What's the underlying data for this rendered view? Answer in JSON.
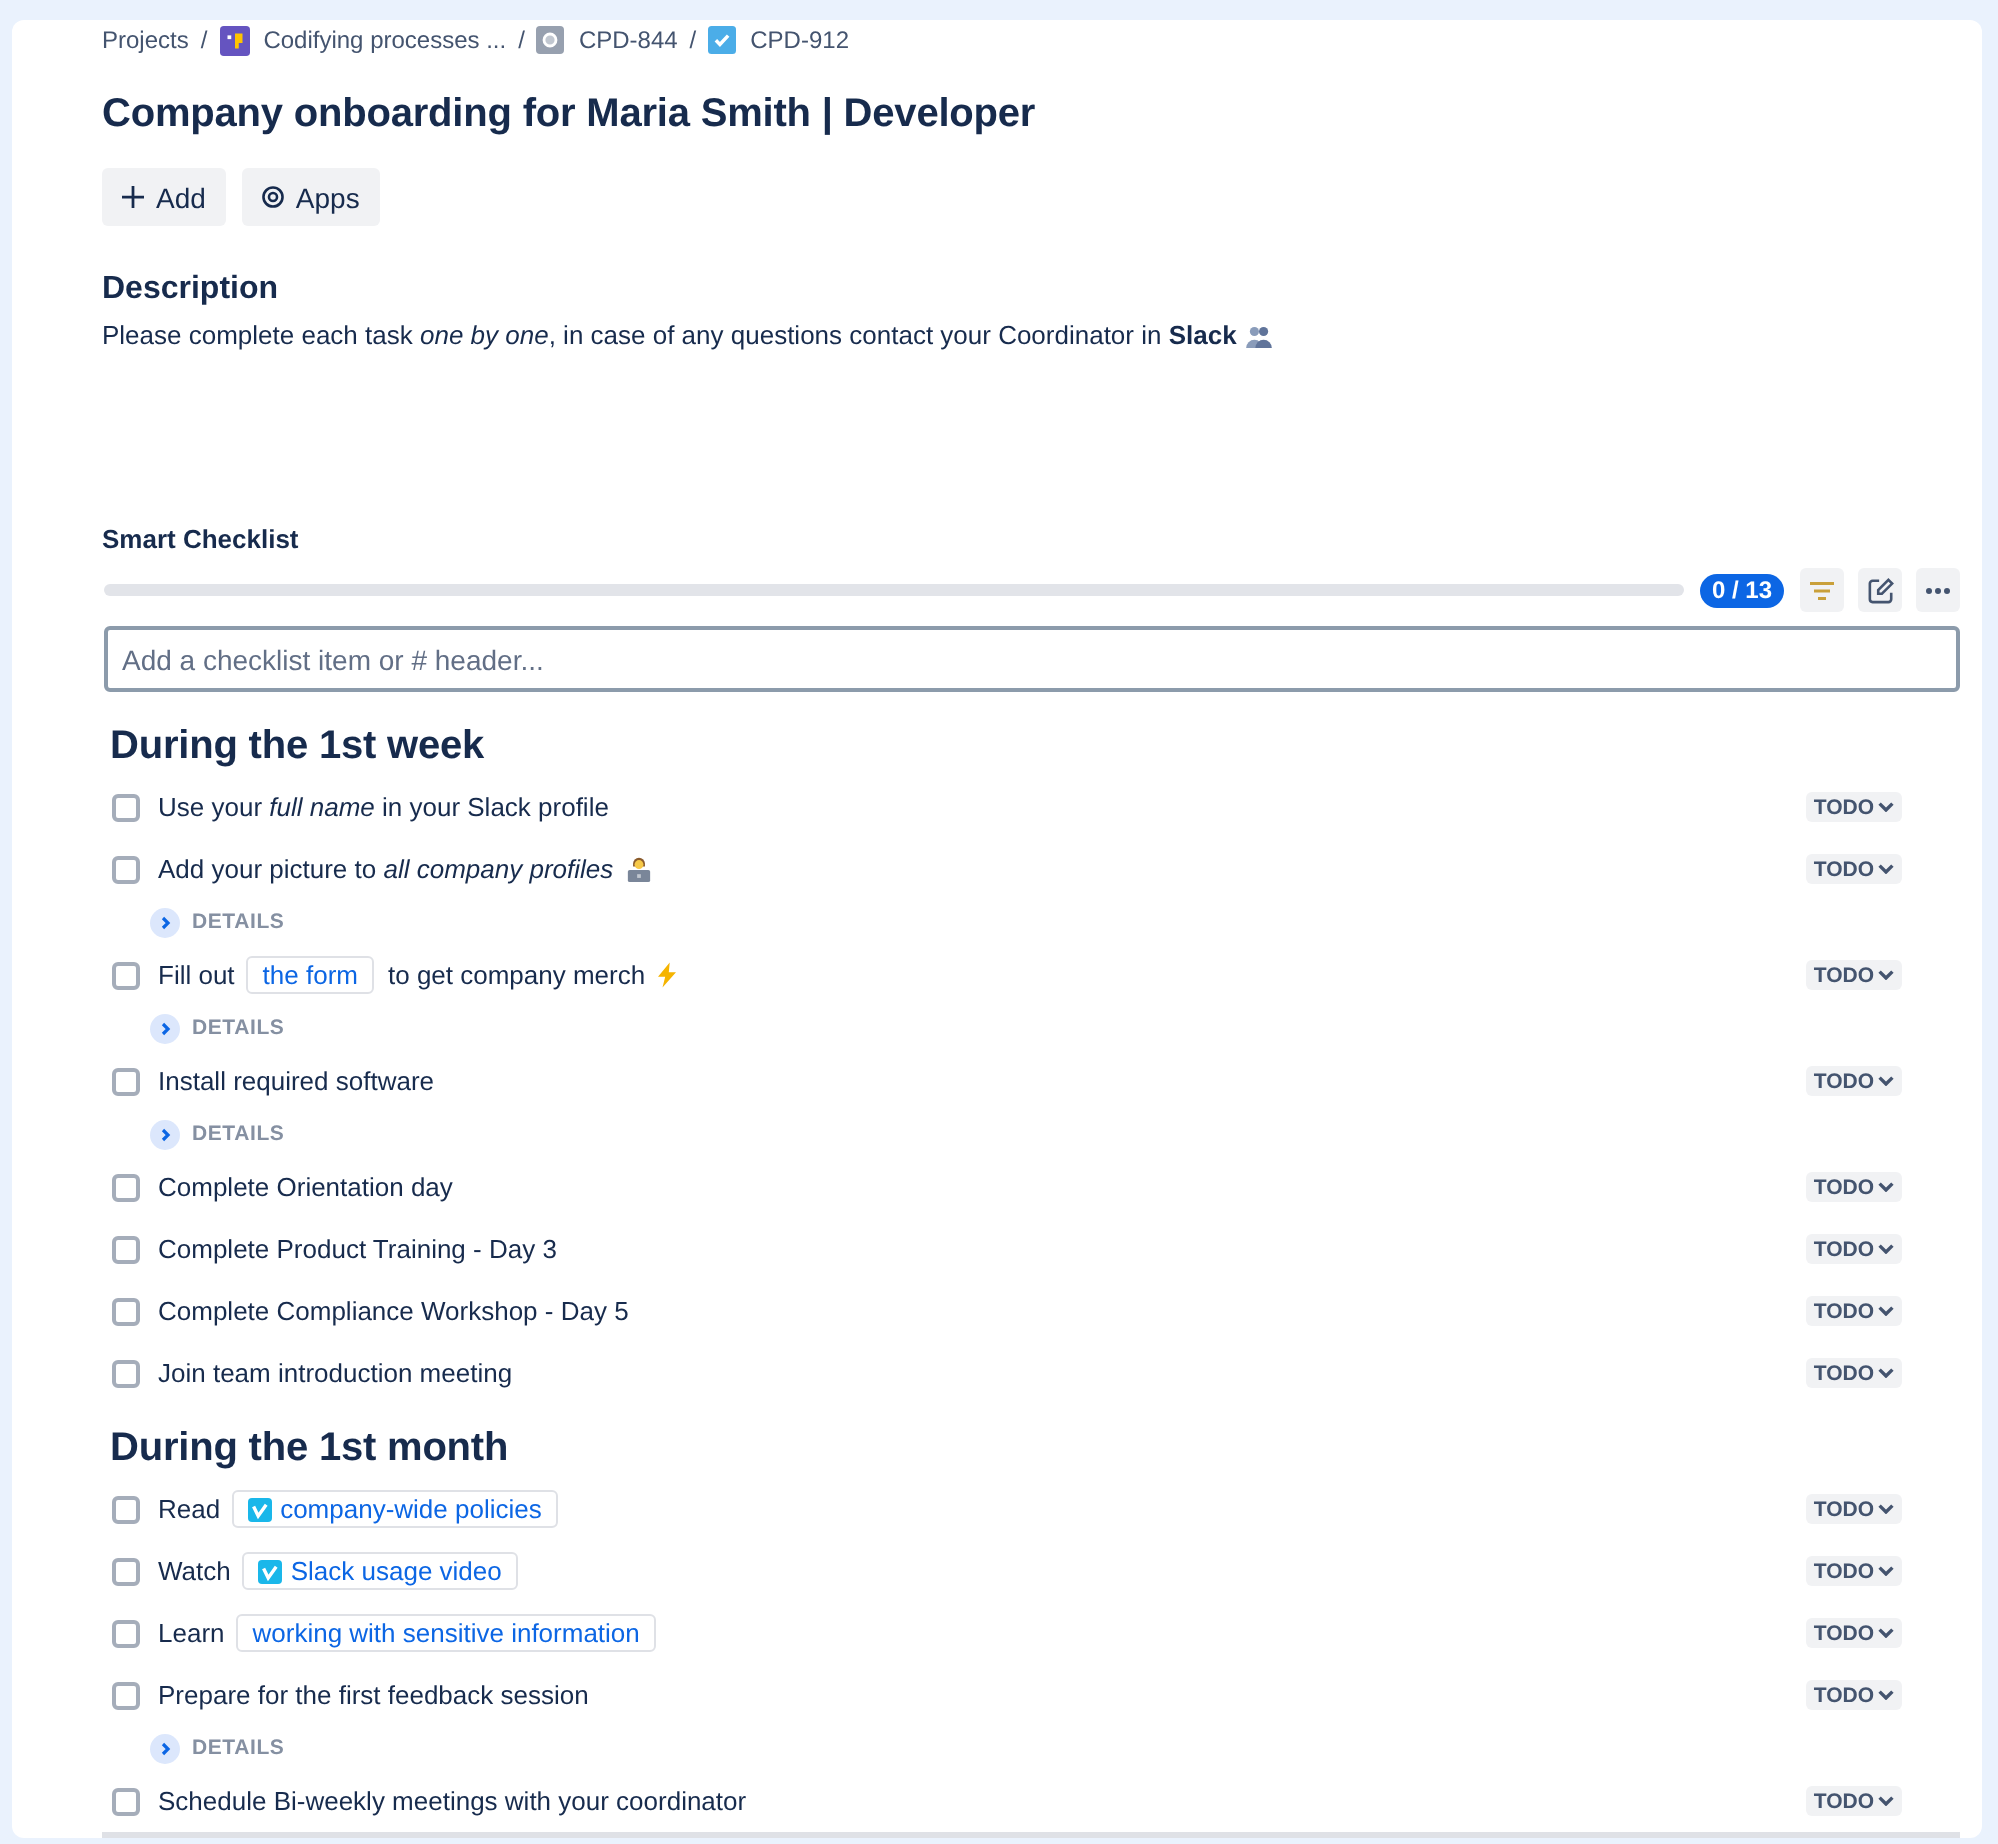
{
  "breadcrumbs": [
    {
      "kind": "plain",
      "label": "Projects",
      "separator": "/"
    },
    {
      "kind": "project",
      "label": "Codifying processes ...",
      "separator": "/"
    },
    {
      "kind": "parent",
      "label": "CPD-844",
      "separator": "/"
    },
    {
      "kind": "task",
      "label": "CPD-912"
    }
  ],
  "title": "Company onboarding for Maria Smith | Developer",
  "actions": [
    {
      "kind": "add",
      "label": "Add"
    },
    {
      "kind": "apps",
      "label": "Apps"
    }
  ],
  "description": {
    "heading": "Description",
    "parts": [
      {
        "kind": "text",
        "text": "Please complete each task *one by one*, in case of any questions contact your Coordinator in **Slack**"
      },
      {
        "kind": "people"
      }
    ]
  },
  "checklist": {
    "title": "Smart Checklist",
    "progress": {
      "level": 0,
      "count": "0 / 13"
    },
    "input": {
      "placeholder": "Add a checklist item or # header..."
    },
    "sections": [
      {
        "title": "During the 1st week",
        "items": [
          {
            "checked": false,
            "status": "TODO",
            "parts": [
              {
                "kind": "text",
                "text": "Use your *full name* in your Slack profile"
              }
            ]
          },
          {
            "checked": false,
            "status": "TODO",
            "parts": [
              {
                "kind": "text",
                "text": "Add your picture to *all company profiles*"
              },
              {
                "kind": "worker"
              }
            ],
            "details": {
              "label": "DETAILS",
              "expanded": false
            }
          },
          {
            "checked": false,
            "status": "TODO",
            "parts": [
              {
                "kind": "text",
                "text": "Fill out"
              },
              {
                "kind": "link",
                "text": "the form",
                "logo": false
              },
              {
                "kind": "text",
                "text": "to get company merch"
              },
              {
                "kind": "bolt"
              }
            ],
            "details": {
              "label": "DETAILS",
              "expanded": false
            }
          },
          {
            "checked": false,
            "status": "TODO",
            "parts": [
              {
                "kind": "text",
                "text": "Install required software"
              }
            ],
            "details": {
              "label": "DETAILS",
              "expanded": false
            }
          },
          {
            "checked": false,
            "status": "TODO",
            "parts": [
              {
                "kind": "text",
                "text": "Complete Orientation day"
              }
            ]
          },
          {
            "checked": false,
            "status": "TODO",
            "parts": [
              {
                "kind": "text",
                "text": "Complete Product Training - Day 3"
              }
            ]
          },
          {
            "checked": false,
            "status": "TODO",
            "parts": [
              {
                "kind": "text",
                "text": "Complete Compliance Workshop - Day 5"
              }
            ]
          },
          {
            "checked": false,
            "status": "TODO",
            "parts": [
              {
                "kind": "text",
                "text": "Join team introduction meeting"
              }
            ]
          }
        ]
      },
      {
        "title": "During the 1st month",
        "items": [
          {
            "checked": false,
            "status": "TODO",
            "parts": [
              {
                "kind": "text",
                "text": "Read"
              },
              {
                "kind": "link",
                "text": "company-wide policies",
                "logo": true
              }
            ]
          },
          {
            "checked": false,
            "status": "TODO",
            "parts": [
              {
                "kind": "text",
                "text": "Watch"
              },
              {
                "kind": "link",
                "text": "Slack usage video",
                "logo": true
              }
            ]
          },
          {
            "checked": false,
            "status": "TODO",
            "parts": [
              {
                "kind": "text",
                "text": "Learn"
              },
              {
                "kind": "link",
                "text": "working with sensitive information",
                "logo": false
              }
            ]
          },
          {
            "checked": false,
            "status": "TODO",
            "parts": [
              {
                "kind": "text",
                "text": "Prepare for the first feedback session"
              }
            ],
            "details": {
              "label": "DETAILS",
              "expanded": false
            }
          },
          {
            "checked": false,
            "status": "TODO",
            "parts": [
              {
                "kind": "text",
                "text": "Schedule Bi-weekly meetings with your coordinator"
              }
            ]
          }
        ]
      }
    ]
  }
}
